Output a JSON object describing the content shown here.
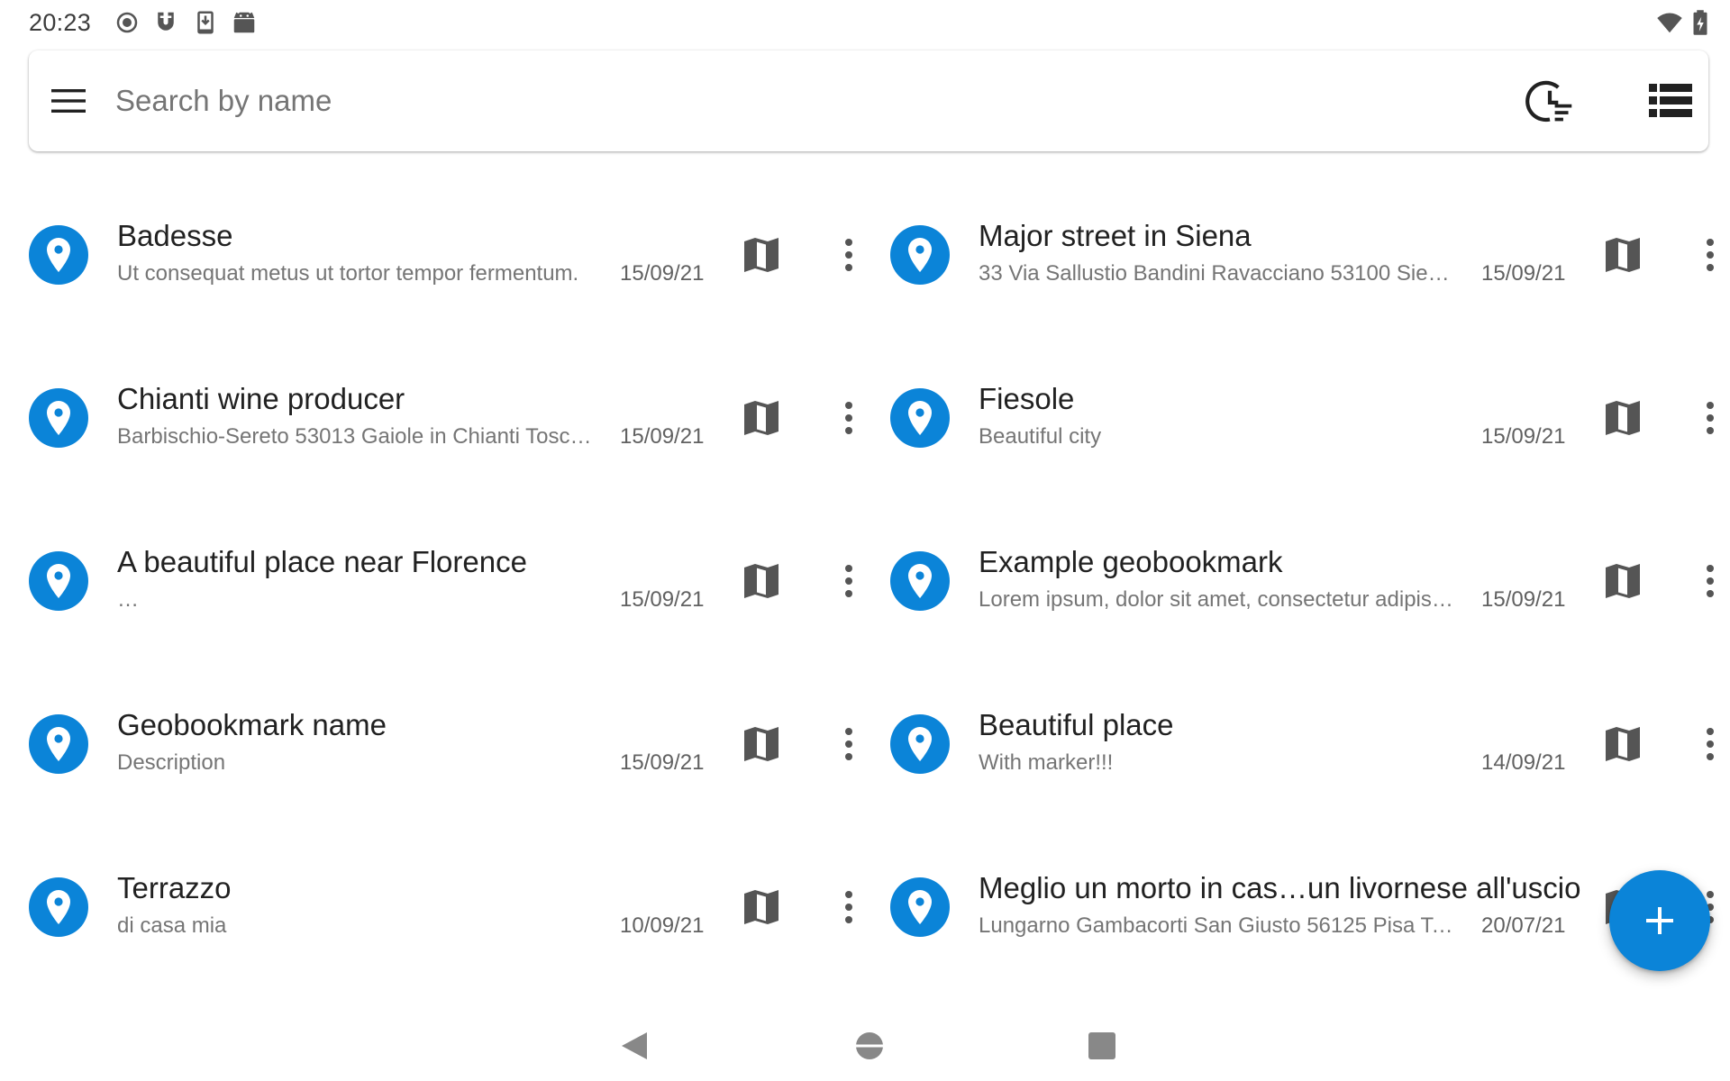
{
  "status_bar": {
    "time": "20:23",
    "left_icons": [
      "radio-button-icon",
      "magnet-icon",
      "download-icon",
      "android-icon"
    ],
    "right_icons": [
      "wifi-icon",
      "battery-charging-icon"
    ]
  },
  "search": {
    "placeholder": "Search by name",
    "menu_icon": "hamburger-menu-icon",
    "sort_icon": "history-sort-icon",
    "view_icon": "list-view-icon"
  },
  "colors": {
    "accent": "#0b84d8",
    "icon_gray": "#555555",
    "text_primary": "#212121",
    "text_secondary": "#757575"
  },
  "items": [
    {
      "title": "Badesse",
      "description": "Ut consequat metus ut tortor tempor fermentum.",
      "date": "15/09/21"
    },
    {
      "title": "Major street in Siena",
      "description": "33 Via Sallustio Bandini Ravacciano 53100 Siena…",
      "date": "15/09/21"
    },
    {
      "title": "Chianti wine producer",
      "description": "Barbischio-Sereto 53013 Gaiole in Chianti Tosca…",
      "date": "15/09/21"
    },
    {
      "title": "Fiesole",
      "description": "Beautiful city",
      "date": "15/09/21"
    },
    {
      "title": "A beautiful place near Florence",
      "description": "…",
      "date": "15/09/21"
    },
    {
      "title": "Example geobookmark",
      "description": "Lorem ipsum, dolor sit amet, consectetur adipisc…",
      "date": "15/09/21"
    },
    {
      "title": "Geobookmark name",
      "description": "Description",
      "date": "15/09/21"
    },
    {
      "title": "Beautiful place",
      "description": "With marker!!!",
      "date": "14/09/21"
    },
    {
      "title": "Terrazzo",
      "description": "di casa mia",
      "date": "10/09/21"
    },
    {
      "title": "Meglio un morto in cas…un livornese all'uscio",
      "description": "Lungarno Gambacorti San Giusto 56125 Pisa Tos…",
      "date": "20/07/21"
    }
  ],
  "fab": {
    "icon": "plus-icon"
  },
  "nav_bar": {
    "icons": [
      "back-icon",
      "home-icon",
      "recents-icon"
    ]
  }
}
